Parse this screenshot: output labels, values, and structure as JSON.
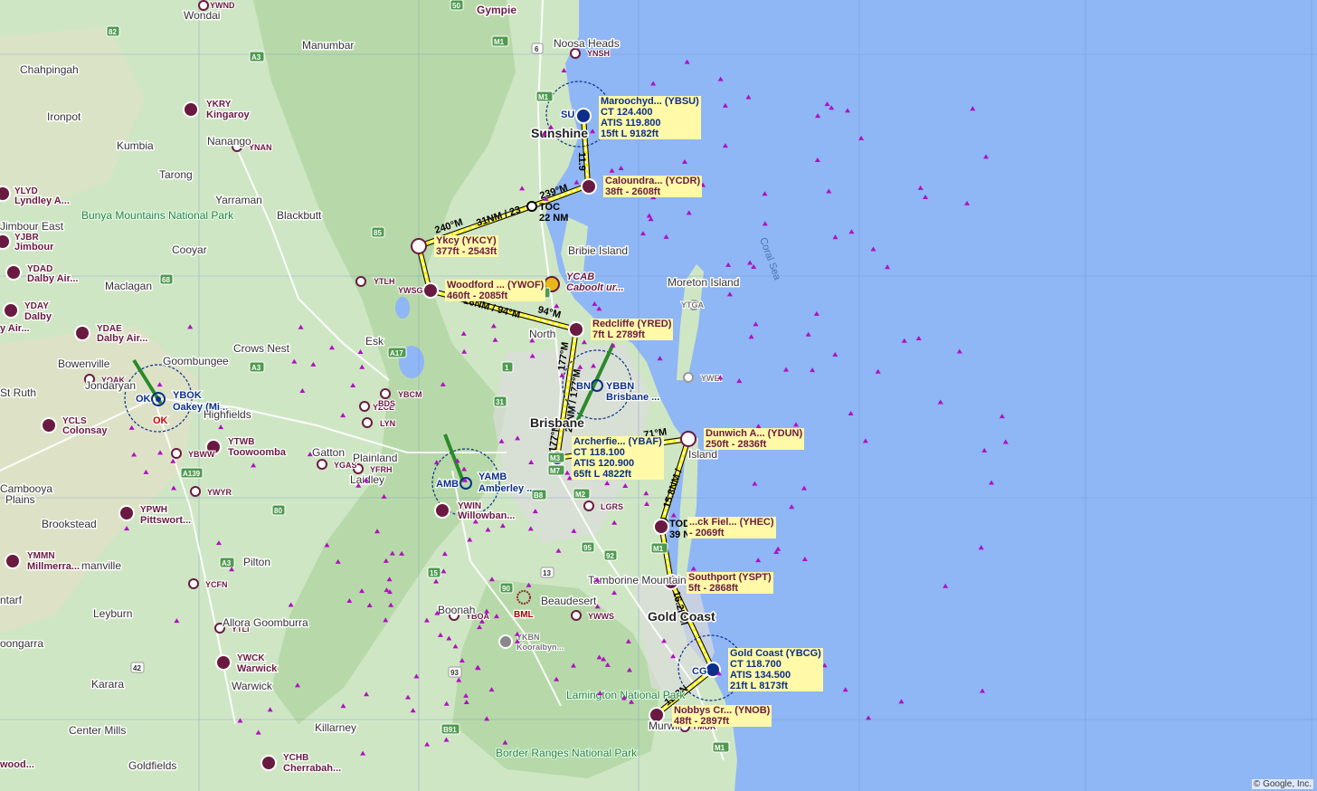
{
  "map": {
    "credit": "© Google, Inc.",
    "colors": {
      "land": "#cfe6c5",
      "sea": "#8fb6f5",
      "route": "#fff200",
      "airport": "#6a1a40",
      "controlled": "#0b2f8a",
      "navaid": "#b010c0"
    }
  },
  "places": [
    {
      "id": "wondai",
      "label": "Wondai"
    },
    {
      "id": "gympie",
      "label": "Gympie"
    },
    {
      "id": "manumbar",
      "label": "Manumbar"
    },
    {
      "id": "noosa",
      "label": "Noosa Heads"
    },
    {
      "id": "chahpingah",
      "label": "Chahpingah"
    },
    {
      "id": "ironpot",
      "label": "Ironpot"
    },
    {
      "id": "kumbia",
      "label": "Kumbia"
    },
    {
      "id": "nanango",
      "label": "Nanango"
    },
    {
      "id": "tarong",
      "label": "Tarong"
    },
    {
      "id": "yarraman",
      "label": "Yarraman"
    },
    {
      "id": "blackbutt",
      "label": "Blackbutt"
    },
    {
      "id": "jimbour-east",
      "label": "Jimbour East"
    },
    {
      "id": "cooyar",
      "label": "Cooyar"
    },
    {
      "id": "maclagan",
      "label": "Maclagan"
    },
    {
      "id": "esk",
      "label": "Esk"
    },
    {
      "id": "crows-nest",
      "label": "Crows Nest"
    },
    {
      "id": "goombungee",
      "label": "Goombungee"
    },
    {
      "id": "bowenville",
      "label": "Bowenville"
    },
    {
      "id": "jondaryan",
      "label": "Jondaryan"
    },
    {
      "id": "st-ruth",
      "label": "St Ruth"
    },
    {
      "id": "highfields",
      "label": "Highfields"
    },
    {
      "id": "gatton",
      "label": "Gatton"
    },
    {
      "id": "plainland",
      "label": "Plainland"
    },
    {
      "id": "laidley",
      "label": "Laidley"
    },
    {
      "id": "cambooya",
      "label": "Cambooya"
    },
    {
      "id": "plains",
      "label": "Plains"
    },
    {
      "id": "brookstead",
      "label": "Brookstead"
    },
    {
      "id": "pilton",
      "label": "Pilton"
    },
    {
      "id": "manville",
      "label": "manville"
    },
    {
      "id": "ntarf",
      "label": "ntarf"
    },
    {
      "id": "leyburn",
      "label": "Leyburn"
    },
    {
      "id": "allora",
      "label": "Allora"
    },
    {
      "id": "goomburra",
      "label": "Goomburra"
    },
    {
      "id": "oongarra",
      "label": "oongarra"
    },
    {
      "id": "karara",
      "label": "Karara"
    },
    {
      "id": "warwick-town",
      "label": "Warwick"
    },
    {
      "id": "center-mills",
      "label": "Center Mills"
    },
    {
      "id": "killarney",
      "label": "Killarney"
    },
    {
      "id": "goldfields",
      "label": "Goldfields"
    },
    {
      "id": "sunshine",
      "label": "Sunshine"
    },
    {
      "id": "bribie",
      "label": "Bribie Island"
    },
    {
      "id": "moreton",
      "label": "Moreton Island"
    },
    {
      "id": "north",
      "label": "North"
    },
    {
      "id": "brisbane",
      "label": "Brisbane"
    },
    {
      "id": "stradbroke",
      "label": "Island"
    },
    {
      "id": "tamborine",
      "label": "Tamborine Mountain"
    },
    {
      "id": "beaudesert",
      "label": "Beaudesert"
    },
    {
      "id": "boonah",
      "label": "Boonah"
    },
    {
      "id": "gold-coast",
      "label": "Gold Coast"
    },
    {
      "id": "murwil",
      "label": "Murwil"
    }
  ],
  "parks": [
    {
      "id": "bunya",
      "label": "Bunya Mountains National Park"
    },
    {
      "id": "lamington",
      "label": "Lamington National Park"
    },
    {
      "id": "border-ranges",
      "label": "Border Ranges National Park"
    }
  ],
  "sea_label": "Coral Sea",
  "roads": [
    "82",
    "A3",
    "85",
    "68",
    "A17",
    "A3",
    "31",
    "A139",
    "80",
    "A3",
    "15",
    "93",
    "95",
    "13",
    "90",
    "92",
    "42",
    "B91",
    "50",
    "M1",
    "M1",
    "M1",
    "M1",
    "M1",
    "M7",
    "M2",
    "B8",
    "M3",
    "1",
    "6"
  ],
  "route": {
    "legs": [
      {
        "id": "l1",
        "label": "11.9"
      },
      {
        "id": "l2",
        "label": "239°M"
      },
      {
        "id": "l3",
        "label": "31NM / 23"
      },
      {
        "id": "l4",
        "label": "240°M"
      },
      {
        "id": "l5",
        "label": "26NM / 94°M"
      },
      {
        "id": "l6",
        "label": "94°M"
      },
      {
        "id": "l7",
        "label": "177°M"
      },
      {
        "id": "l8",
        "label": "22NM / 177°M"
      },
      {
        "id": "l9",
        "label": "177°M"
      },
      {
        "id": "l10",
        "label": "71°M"
      },
      {
        "id": "l11",
        "label": "15.8NM /"
      },
      {
        "id": "l12",
        "label": "16.2NM"
      },
      {
        "id": "l13",
        "label": "12.3N"
      }
    ],
    "markers": [
      {
        "id": "toc",
        "label": "TOC",
        "sub": "22 NM"
      },
      {
        "id": "tod",
        "label": "TOD",
        "sub": "39 NM"
      }
    ]
  },
  "route_airports": [
    {
      "id": "ybsu",
      "lines": [
        "Maroochyd... (YBSU)",
        "CT 124.400",
        "ATIS 119.800",
        "15ft L 9182ft"
      ],
      "controlled": true
    },
    {
      "id": "ycdr",
      "lines": [
        "Caloundra... (YCDR)",
        "38ft - 2608ft"
      ]
    },
    {
      "id": "ykcy",
      "lines": [
        "Ykcy (YKCY)",
        "377ft - 2543ft"
      ]
    },
    {
      "id": "ywof",
      "lines": [
        "Woodford ... (YWOF)",
        "460ft - 2085ft"
      ]
    },
    {
      "id": "yred",
      "lines": [
        "Redcliffe (YRED)",
        "7ft L 2789ft"
      ]
    },
    {
      "id": "ybaf",
      "lines": [
        "Archerfie... (YBAF)",
        "CT 118.100",
        "ATIS 120.900",
        "65ft L 4822ft"
      ],
      "controlled": true
    },
    {
      "id": "ydun",
      "lines": [
        "Dunwich A... (YDUN)",
        "250ft - 2836ft"
      ]
    },
    {
      "id": "yhec",
      "lines": [
        "...ck Fiel... (YHEC)",
        "- 2069ft"
      ]
    },
    {
      "id": "yspt",
      "lines": [
        "Southport (YSPT)",
        "5ft - 2868ft"
      ]
    },
    {
      "id": "ybcg",
      "lines": [
        "Gold Coast (YBCG)",
        "CT 118.700",
        "ATIS 134.500",
        "21ft L 8173ft"
      ],
      "controlled": true
    },
    {
      "id": "ynob",
      "lines": [
        "Nobbys Cr... (YNOB)",
        "48ft - 2897ft"
      ]
    }
  ],
  "other_airports": [
    {
      "id": "ykry",
      "code": "YKRY",
      "name": "Kingaroy"
    },
    {
      "id": "ylyd",
      "code": "YLYD",
      "name": "Lyndley A..."
    },
    {
      "id": "yjbr",
      "code": "YJBR",
      "name": "Jimbour"
    },
    {
      "id": "ydad",
      "code": "YDAD",
      "name": "Dalby Air..."
    },
    {
      "id": "yday",
      "code": "YDAY",
      "name": "Dalby"
    },
    {
      "id": "ydae",
      "code": "YDAE",
      "name": "Dalby Air..."
    },
    {
      "id": "ycls",
      "code": "YCLS",
      "name": "Colonsay"
    },
    {
      "id": "ytwb",
      "code": "YTWB",
      "name": "Toowoomba"
    },
    {
      "id": "ypwh",
      "code": "YPWH",
      "name": "Pittswort..."
    },
    {
      "id": "ymmn",
      "code": "YMMN",
      "name": "Millmerra..."
    },
    {
      "id": "ywck",
      "code": "YWCK",
      "name": "Warwick"
    },
    {
      "id": "ychb",
      "code": "YCHB",
      "name": "Cherrabah..."
    },
    {
      "id": "ywin",
      "code": "YWIN",
      "name": "Willowban..."
    },
    {
      "id": "ybok",
      "code": "YBOK",
      "name": "Oakey (Mi..."
    },
    {
      "id": "ybbn",
      "code": "YBBN",
      "name": "Brisbane ..."
    },
    {
      "id": "yamb",
      "code": "YAMB",
      "name": "Amberley ..."
    },
    {
      "id": "ykbn",
      "code": "YKBN",
      "name": "Kooralbyn..."
    },
    {
      "id": "ycab",
      "code": "YCAB",
      "name": "Caboolt ur..."
    },
    {
      "id": "wood",
      "code": "",
      "name": "wood..."
    },
    {
      "id": "y-left",
      "code": "",
      "name": "y Air..."
    }
  ],
  "small_fields": [
    "YWND",
    "YNSH",
    "YNAN",
    "YTLH",
    "YWSG",
    "YTGA",
    "YWEI",
    "YOAK",
    "YBCM",
    "YZCE",
    "LYN",
    "YGAS",
    "YFRH",
    "YBWW",
    "YWYR",
    "YCFN",
    "YTLI",
    "YBOA",
    "YWWS",
    "LGRS",
    "YMUR",
    "BDS"
  ],
  "controlled_codes": [
    "SU",
    "BN",
    "OK",
    "AMB",
    "CG",
    "OK"
  ],
  "other_labels": [
    "BML"
  ]
}
